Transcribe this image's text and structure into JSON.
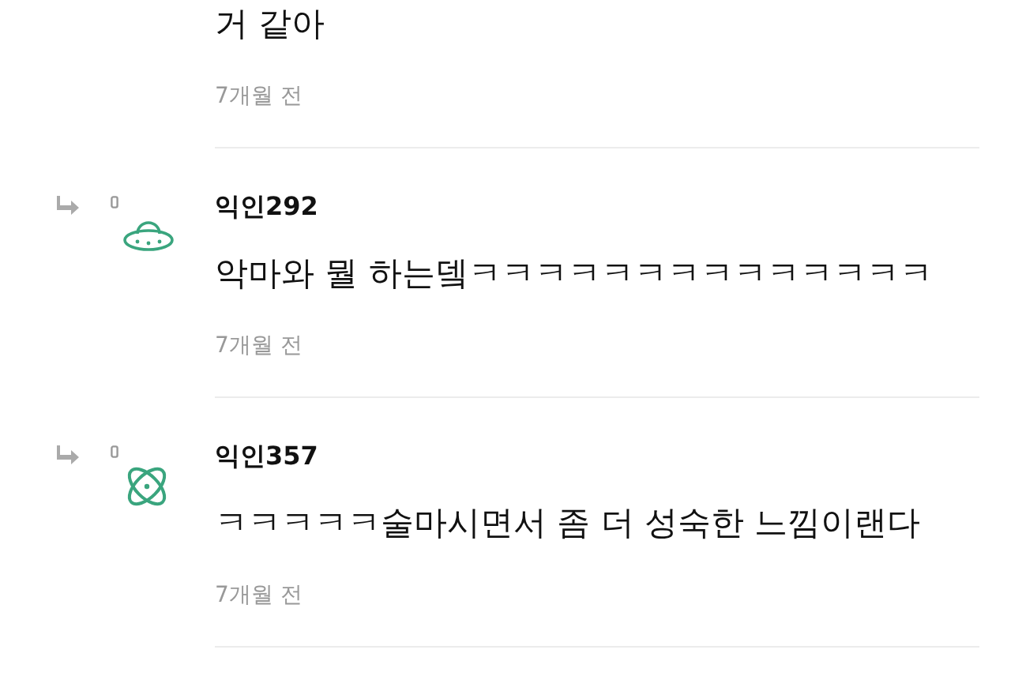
{
  "comments": [
    {
      "reply": false,
      "text": "거 같아",
      "time": "7개월 전"
    },
    {
      "reply": true,
      "kind": "saucer",
      "name": "익인292",
      "text": "악마와 뭘 하는뎈ㅋㅋㅋㅋㅋㅋㅋㅋㅋㅋㅋㅋㅋㅋ",
      "time": "7개월 전"
    },
    {
      "reply": true,
      "kind": "atom",
      "name": "익인357",
      "text": "ㅋㅋㅋㅋㅋ술마시면서 좀 더 성숙한 느낌이랜다",
      "time": "7개월 전"
    }
  ]
}
